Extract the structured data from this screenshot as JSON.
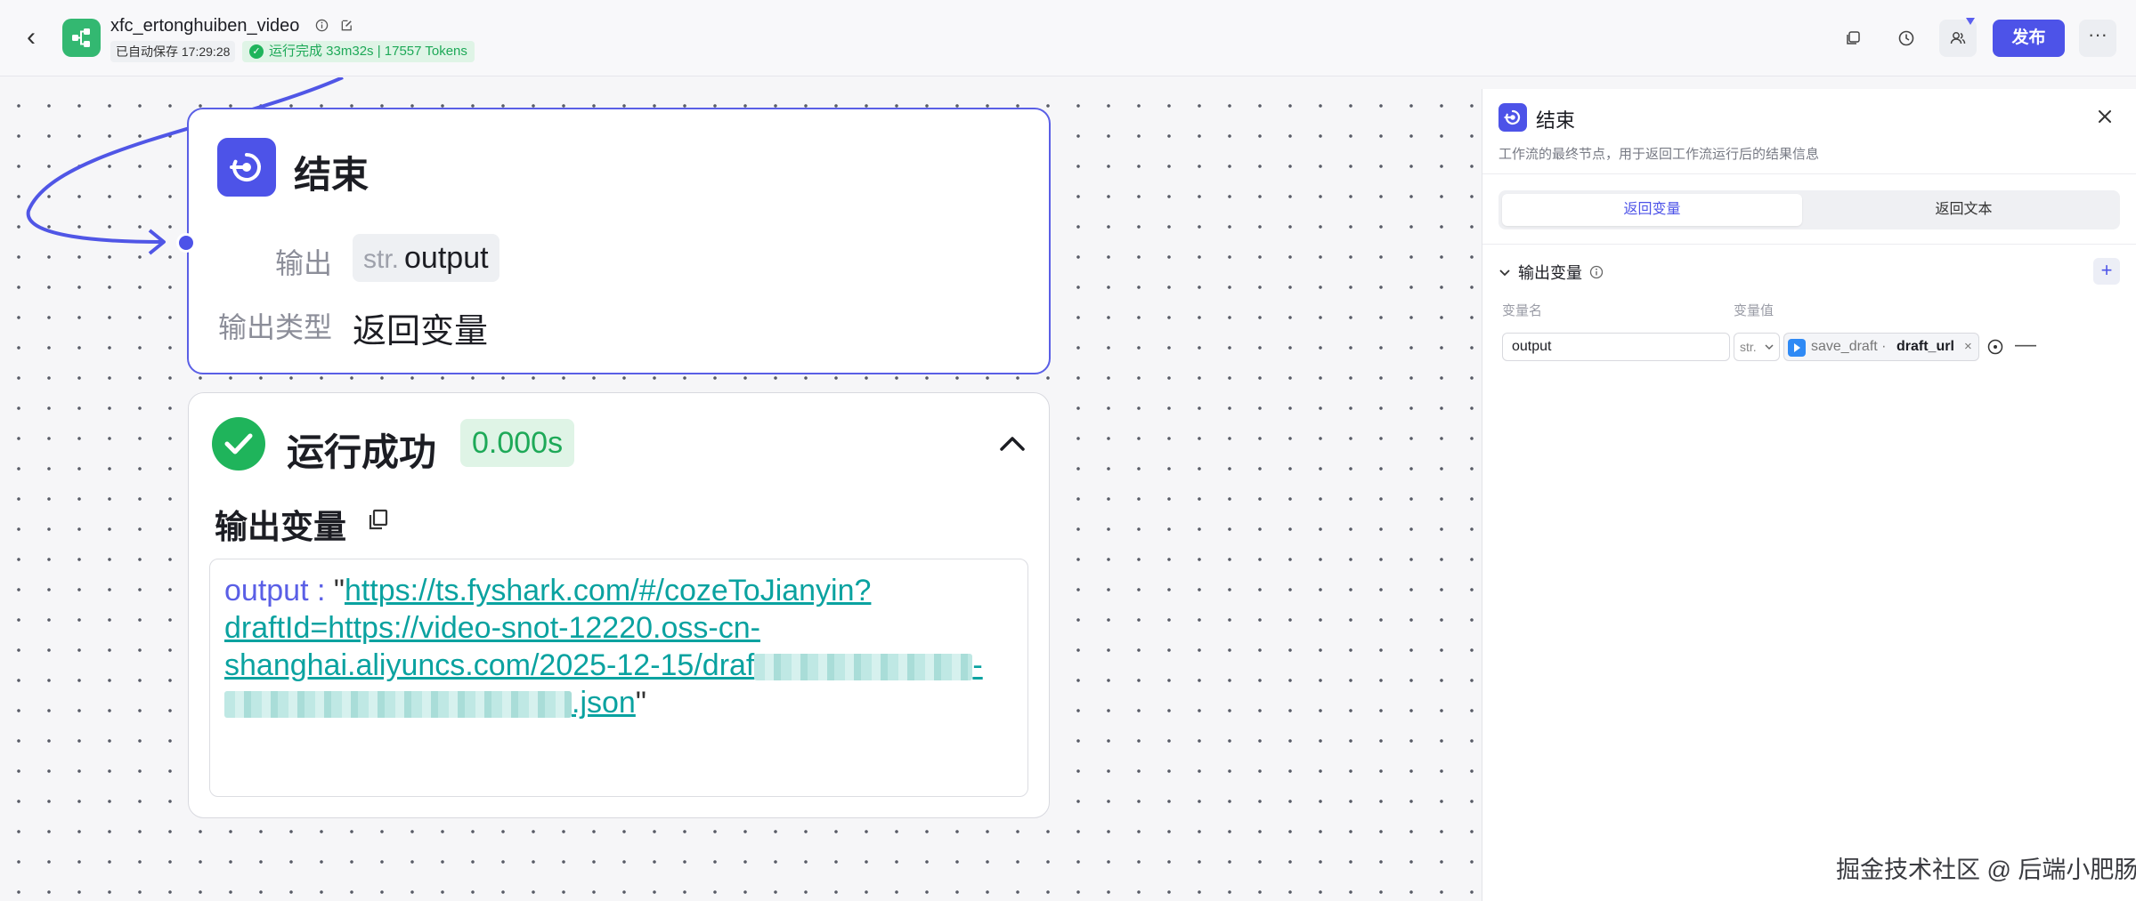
{
  "header": {
    "title": "xfc_ertonghuiben_video",
    "saved_text": "已自动保存 17:29:28",
    "run_status": "运行完成 33m32s | 17557 Tokens",
    "publish_label": "发布",
    "more_label": "···"
  },
  "end_node": {
    "title": "结束",
    "output_label": "输出",
    "output_type_tag": "str.",
    "output_name": "output",
    "output_type_label": "输出类型",
    "output_type_value": "返回变量"
  },
  "run_result": {
    "status": "运行成功",
    "duration": "0.000s",
    "output_title": "输出变量",
    "output_key": "output : ",
    "quote_open": "\"",
    "url_part1": "https://ts.fyshark.com/#/cozeToJianyin?",
    "url_part2": "draftId=https://video-snot-12220.oss-cn-",
    "url_part3": "shanghai.aliyuncs.com/2025-12-15/draf",
    "url_part4": "-",
    "url_part5": ".json",
    "quote_close": "\""
  },
  "panel": {
    "title": "结束",
    "description": "工作流的最终节点，用于返回工作流运行后的结果信息",
    "tab_active": "返回变量",
    "tab_inactive": "返回文本",
    "section_title": "输出变量",
    "col_name": "变量名",
    "col_value": "变量值",
    "var_name": "output",
    "var_type": "str.",
    "ref_source": "save_draft · ",
    "ref_var": "draft_url",
    "ref_clear": "×",
    "add_label": "+",
    "remove_label": "—"
  },
  "watermark": "掘金技术社区 @ 后端小肥肠",
  "colors": {
    "accent": "#4d53e8",
    "success": "#1fb45b",
    "link": "#0aa2a0"
  },
  "icons": [
    "back-icon",
    "workflow-icon",
    "info-icon",
    "edit-icon",
    "copy-icon",
    "history-icon",
    "collaborator-icon",
    "end-node-icon",
    "check-icon",
    "chevron-up-icon",
    "close-icon",
    "chevron-down-icon",
    "plus-icon",
    "plugin-icon"
  ]
}
